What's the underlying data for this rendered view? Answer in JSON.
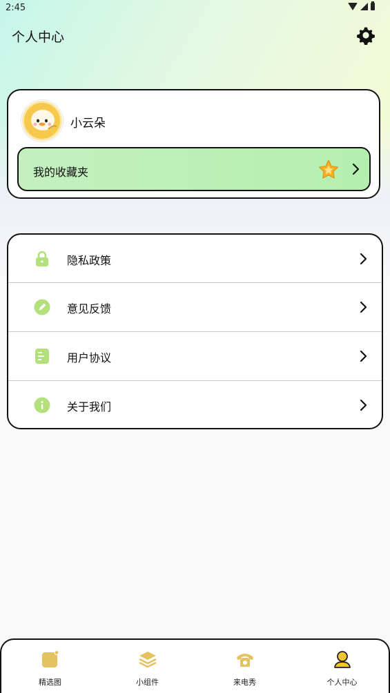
{
  "status_bar": {
    "time": "2:45",
    "icons": [
      "wifi-icon",
      "signal-icon",
      "battery-icon"
    ]
  },
  "header": {
    "title": "个人中心",
    "settings_icon": "gear-icon"
  },
  "profile": {
    "username": "小云朵",
    "avatar_icon": "duck-avatar",
    "favorites": {
      "label": "我的收藏夹",
      "icon": "star-icon"
    }
  },
  "menu": {
    "items": [
      {
        "label": "隐私政策",
        "icon": "lock-icon"
      },
      {
        "label": "意见反馈",
        "icon": "pencil-icon"
      },
      {
        "label": "用户协议",
        "icon": "document-icon"
      },
      {
        "label": "关于我们",
        "icon": "info-icon"
      }
    ]
  },
  "bottom_nav": {
    "items": [
      {
        "label": "精选图",
        "icon": "image-icon",
        "active": false
      },
      {
        "label": "小组件",
        "icon": "layers-icon",
        "active": false
      },
      {
        "label": "来电秀",
        "icon": "phone-icon",
        "active": false
      },
      {
        "label": "个人中心",
        "icon": "user-icon",
        "active": true
      }
    ]
  },
  "colors": {
    "accent_green": "#b4efaf",
    "icon_green": "#b3e07a",
    "nav_icon": "#e4c262",
    "nav_active": "#f1c62f",
    "star": "#f4b32b"
  }
}
